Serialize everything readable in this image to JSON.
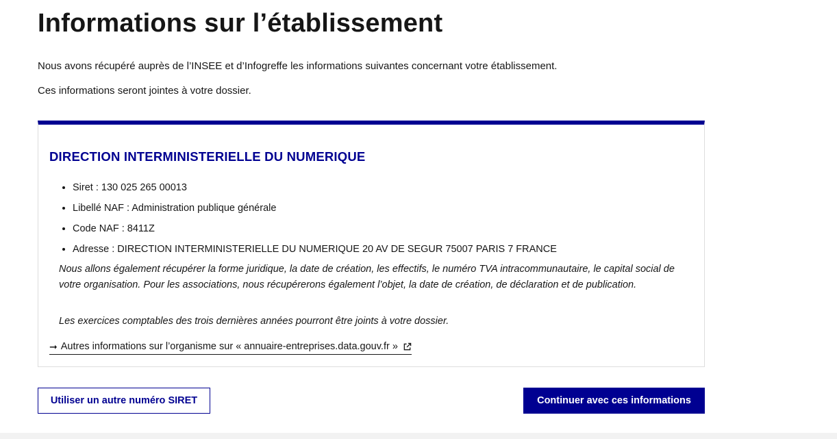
{
  "page": {
    "title": "Informations sur l’établissement",
    "intro_1": "Nous avons récupéré auprès de l’INSEE et d’Infogreffe les informations suivantes concernant votre établissement.",
    "intro_2": "Ces informations seront jointes à votre dossier."
  },
  "card": {
    "title": "DIRECTION INTERMINISTERIELLE DU NUMERIQUE",
    "items": [
      "Siret : 130 025 265 00013",
      "Libellé NAF : Administration publique générale",
      "Code NAF : 8411Z",
      "Adresse : DIRECTION INTERMINISTERIELLE DU NUMERIQUE 20 AV DE SEGUR 75007 PARIS 7 FRANCE"
    ],
    "note_1": "Nous allons également récupérer la forme juridique, la date de création, les effectifs, le numéro TVA intracommunautaire, le capital social de votre organisation. Pour les associations, nous récupérerons également l’objet, la date de création, de déclaration et de publication.",
    "note_2": "Les exercices comptables des trois dernières années pourront être joints à votre dossier.",
    "link_arrow": "➞",
    "link_label": "Autres informations sur l’organisme sur « annuaire-entreprises.data.gouv.fr »"
  },
  "actions": {
    "other_siret": "Utiliser un autre numéro SIRET",
    "continue": "Continuer avec ces informations"
  },
  "colors": {
    "accent": "#000091",
    "text": "#161616",
    "border": "#dddddd",
    "footer": "#f2f2f2"
  },
  "icons": {
    "link_arrow": "arrow-right-icon",
    "external": "external-link-icon"
  }
}
